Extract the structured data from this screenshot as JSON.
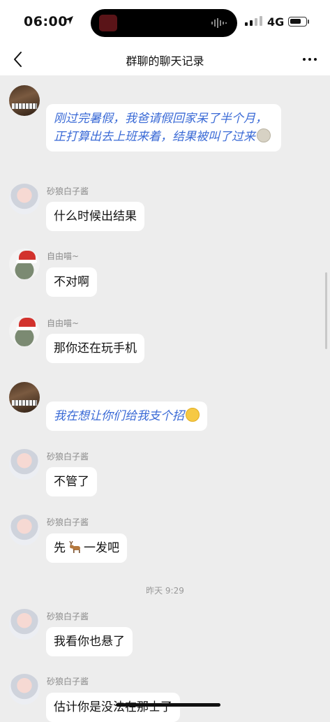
{
  "status": {
    "time": "06:00",
    "network": "4G"
  },
  "nav": {
    "title": "群聊的聊天记录"
  },
  "messages": [
    {
      "sender": "",
      "text": "刚过完暑假，我爸请假回家呆了半个月，正打算出去上班来着，结果被叫了过来",
      "style": "blue",
      "emoji": "gray"
    },
    {
      "sender": "砂狼白子酱",
      "text": "什么时候出结果"
    },
    {
      "sender": "自由喵~",
      "text": "不对啊"
    },
    {
      "sender": "自由喵~",
      "text": "那你还在玩手机"
    },
    {
      "sender": "",
      "text": "我在想让你们给我支个招",
      "style": "blue",
      "emoji": "yellow"
    },
    {
      "sender": "砂狼白子酱",
      "text": "不管了"
    },
    {
      "sender": "砂狼白子酱",
      "text_before": "先",
      "text_after": "一发吧"
    },
    {
      "sender": "砂狼白子酱",
      "text": "我看你也悬了"
    },
    {
      "sender": "砂狼白子酱",
      "text": "估计你是没法在那士了"
    }
  ],
  "timestamp": "昨天 9:29"
}
